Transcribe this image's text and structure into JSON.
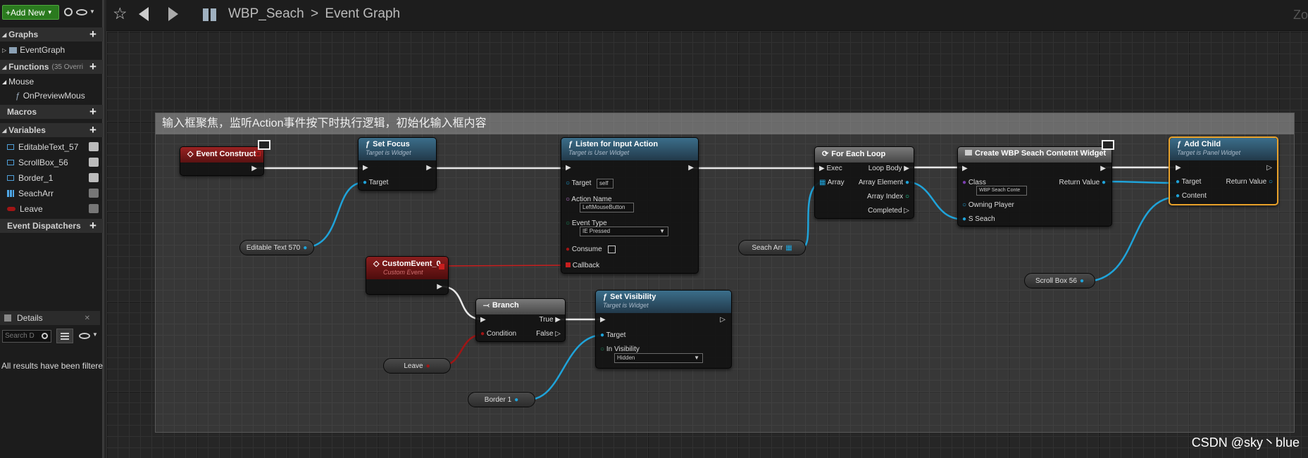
{
  "toolbar": {
    "add_new_label": "+Add New"
  },
  "breadcrumb": {
    "blueprint": "WBP_Seach",
    "separator": ">",
    "graph": "Event Graph",
    "zoom_partial": "Zo"
  },
  "my_blueprint": {
    "graphs_label": "Graphs",
    "event_graph_label": "EventGraph",
    "functions_label": "Functions",
    "functions_count": "(35 Overri",
    "mouse_category": "Mouse",
    "mouse_item": "OnPreviewMous",
    "macros_label": "Macros",
    "variables_label": "Variables",
    "variables": [
      "EditableText_57",
      "ScrollBox_56",
      "Border_1",
      "SeachArr",
      "Leave"
    ],
    "dispatchers_label": "Event Dispatchers"
  },
  "details": {
    "title": "Details",
    "search_placeholder": "Search D",
    "message": "All results have been filtere"
  },
  "comment": {
    "title": "输入框聚焦，监听Action事件按下时执行逻辑，初始化输入框内容"
  },
  "nodes": {
    "event_construct": {
      "title": "Event Construct"
    },
    "set_focus": {
      "title": "Set Focus",
      "subtitle": "Target is Widget",
      "pin_target": "Target"
    },
    "listen_input": {
      "title": "Listen for Input Action",
      "subtitle": "Target is User Widget",
      "pin_target": "Target",
      "target_value": "self",
      "pin_action": "Action Name",
      "action_value": "LeftMouseButton",
      "pin_event_type": "Event Type",
      "event_type_value": "IE Pressed",
      "pin_consume": "Consume",
      "pin_callback": "Callback"
    },
    "for_each": {
      "title": "For Each Loop",
      "pin_exec": "Exec",
      "pin_array": "Array",
      "pin_loop_body": "Loop Body",
      "pin_array_element": "Array Element",
      "pin_array_index": "Array Index",
      "pin_completed": "Completed"
    },
    "create_widget": {
      "title": "Create WBP Seach Contetnt Widget",
      "pin_class": "Class",
      "class_value": "WBP Seach Conte",
      "pin_owning": "Owning Player",
      "pin_s_seach": "S Seach",
      "pin_return": "Return Value"
    },
    "add_child": {
      "title": "Add Child",
      "subtitle": "Target is Panel Widget",
      "pin_target": "Target",
      "pin_content": "Content",
      "pin_return": "Return Value"
    },
    "custom_event": {
      "title": "CustomEvent_0",
      "subtitle": "Custom Event"
    },
    "branch": {
      "title": "Branch",
      "pin_condition": "Condition",
      "pin_true": "True",
      "pin_false": "False"
    },
    "set_visibility": {
      "title": "Set Visibility",
      "subtitle": "Target is Widget",
      "pin_target": "Target",
      "pin_vis": "In Visibility",
      "vis_value": "Hidden"
    },
    "var_editable": {
      "label": "Editable Text 570"
    },
    "var_seach": {
      "label": "Seach Arr"
    },
    "var_scroll": {
      "label": "Scroll Box 56"
    },
    "var_leave": {
      "label": "Leave"
    },
    "var_border": {
      "label": "Border 1"
    }
  },
  "watermark": "CSDN @sky丶blue",
  "colors": {
    "exec_wire": "#e8e8e8",
    "object_wire": "#1fa3d9",
    "bool_wire": "#a01515",
    "delegate_wire": "#c81e1e",
    "comment_bg": "#5a5a5a",
    "selection": "#e8a12a"
  }
}
